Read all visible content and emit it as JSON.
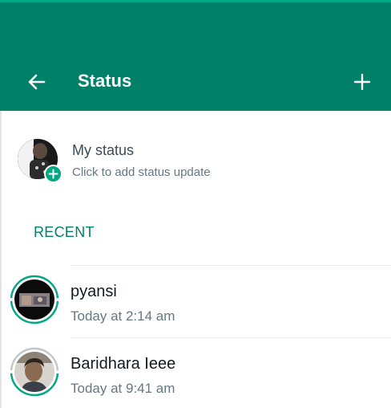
{
  "header": {
    "title": "Status",
    "back_icon": "arrow-left-icon",
    "add_icon": "plus-icon",
    "bg_color": "#008069"
  },
  "my_status": {
    "name": "My status",
    "subtitle": "Click to add status update",
    "badge_icon": "plus-icon",
    "badge_color": "#00a884"
  },
  "recent": {
    "label": "RECENT",
    "items": [
      {
        "name": "pyansi",
        "time": "Today at 2:14 am",
        "ring": "unseen"
      },
      {
        "name": "Baridhara Ieee",
        "time": "Today at 9:41 am",
        "ring": "partially-seen"
      }
    ]
  },
  "colors": {
    "accent": "#00a884",
    "seen": "#bfc7cb"
  }
}
